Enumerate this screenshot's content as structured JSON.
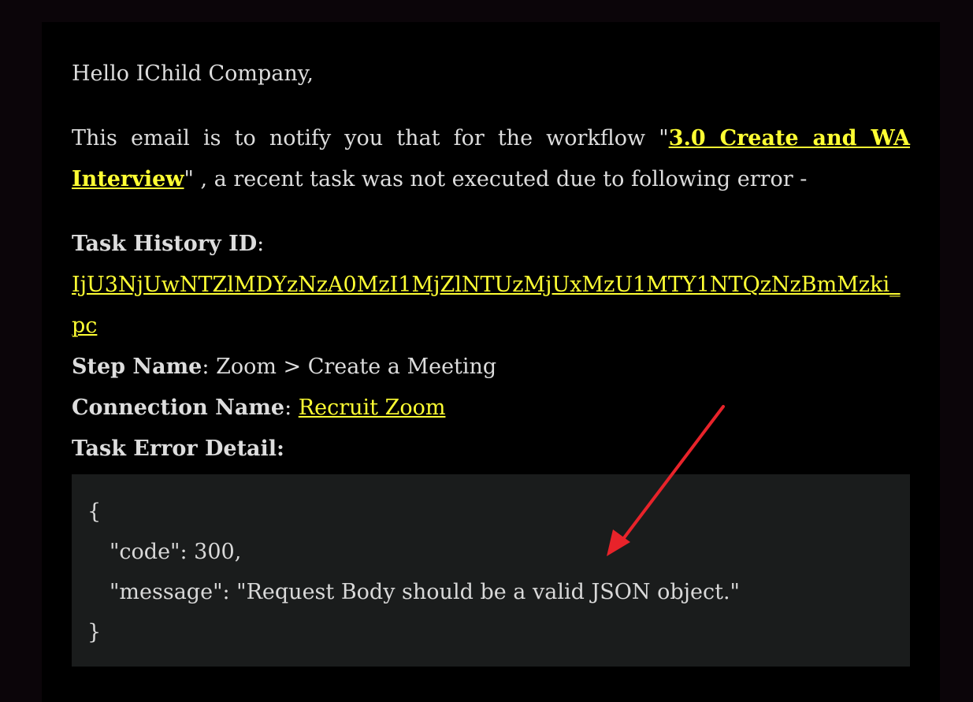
{
  "email": {
    "greeting": "Hello IChild Company,",
    "notify_prefix": "This email is to notify you that for the workflow \"",
    "workflow_name": "3.0 Create and WA Interview",
    "notify_suffix": "\" , a recent task was not executed due to following error -",
    "task_history_label": "Task History ID",
    "task_history_id": "IjU3NjUwNTZlMDYzNzA0MzI1MjZlNTUzMjUxMzU1MTY1NTQzNzBmMzki_pc",
    "step_name_label": "Step Name",
    "step_name_value": "Zoom > Create a Meeting",
    "connection_label": "Connection Name",
    "connection_value": "Recruit Zoom",
    "error_detail_label": "Task Error Detail:",
    "separator": ":",
    "error_json": {
      "open": "{",
      "code_line": "\"code\": 300,",
      "message_line": "\"message\": \"Request Body should be a valid JSON object.\"",
      "close": "}"
    }
  },
  "annotation": {
    "arrow_color": "#e8232a",
    "icon": "red-arrow-icon"
  },
  "colors": {
    "link": "#ffff33",
    "background": "#000000",
    "code_bg": "#1a1c1c"
  }
}
